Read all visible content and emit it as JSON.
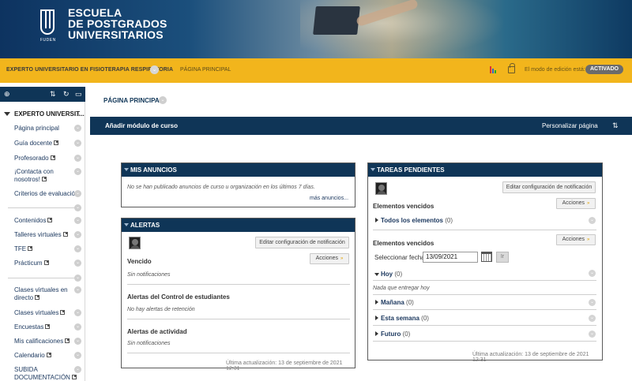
{
  "banner": {
    "logo_sub": "FUDEN",
    "title_line1": "ESCUELA",
    "title_line2": "DE POSTGRADOS",
    "title_line3": "UNIVERSITARIOS"
  },
  "coursebar": {
    "course_name": "EXPERTO UNIVERSITARIO EN FISIOTERAPIA RESPIRATORIA",
    "page_link": "PÁGINA PRINCIPAL",
    "edit_label": "El modo de edición está:",
    "edit_state": "ACTIVADO"
  },
  "sidebar": {
    "tools": [
      "⊕",
      "⇅",
      "↻",
      "▭"
    ],
    "course_title": "EXPERTO UNIVERSIT...",
    "items": [
      {
        "label": "Página principal",
        "ext": false
      },
      {
        "label": "Guía docente",
        "ext": true
      },
      {
        "label": "Profesorado",
        "ext": true
      },
      {
        "label_line1": "¡Contacta con",
        "label_line2": "nosotros!",
        "ext": true
      },
      {
        "label": "Criterios de evaluación",
        "ext": false
      },
      {
        "label": "Contenidos",
        "ext": true
      },
      {
        "label": "Talleres virtuales",
        "ext": true
      },
      {
        "label": "TFE",
        "ext": true
      },
      {
        "label": "Prácticum",
        "ext": true
      },
      {
        "label_line1": "Clases virtuales en",
        "label_line2": "directo",
        "ext": true
      },
      {
        "label": "Clases virtuales",
        "ext": true
      },
      {
        "label": "Encuestas",
        "ext": true
      },
      {
        "label": "Mis calificaciones",
        "ext": true
      },
      {
        "label": "Calendario",
        "ext": true
      },
      {
        "label_line1": "SUBIDA",
        "label_line2": "DOCUMENTACIÓN",
        "ext": true
      }
    ]
  },
  "main": {
    "title": "PÁGINA PRINCIPAL",
    "add_module": "Añadir módulo de curso",
    "customize": "Personalizar página"
  },
  "anuncios": {
    "title": "MIS ANUNCIOS",
    "empty": "No se han publicado anuncios de curso u organización en los últimos 7 días.",
    "more": "más anuncios..."
  },
  "alertas": {
    "title": "ALERTAS",
    "edit_btn": "Editar configuración de notificación",
    "actions_btn": "Acciones",
    "sections": [
      {
        "label": "Vencido",
        "text": "Sin notificaciones"
      },
      {
        "label": "Alertas del Control de estudiantes",
        "text": "No hay alertas de retención"
      },
      {
        "label": "Alertas de actividad",
        "text": "Sin notificaciones"
      }
    ],
    "footer": "Última actualización: 13 de septiembre de 2021 12:31"
  },
  "tareas": {
    "title": "TAREAS PENDIENTES",
    "edit_btn": "Editar configuración de notificación",
    "actions_btn": "Acciones",
    "vencidos_label": "Elementos vencidos",
    "todos": "Todos los elementos",
    "todos_count": "(0)",
    "vencidos_label2": "Elementos vencidos",
    "actions_btn2": "Acciones",
    "date_label": "Seleccionar fecha:",
    "date_value": "13/09/2021",
    "go": "Ir",
    "hoy": "Hoy",
    "hoy_count": "(0)",
    "hoy_text": "Nada que entregar hoy",
    "manana": "Mañana",
    "manana_count": "(0)",
    "semana": "Esta semana",
    "semana_count": "(0)",
    "futuro": "Futuro",
    "futuro_count": "(0)",
    "footer": "Última actualización: 13 de septiembre de 2021 12:31"
  },
  "colors": {
    "navy": "#0f3557",
    "yellow": "#f2b51c",
    "toggle": "#6b6b6b"
  }
}
